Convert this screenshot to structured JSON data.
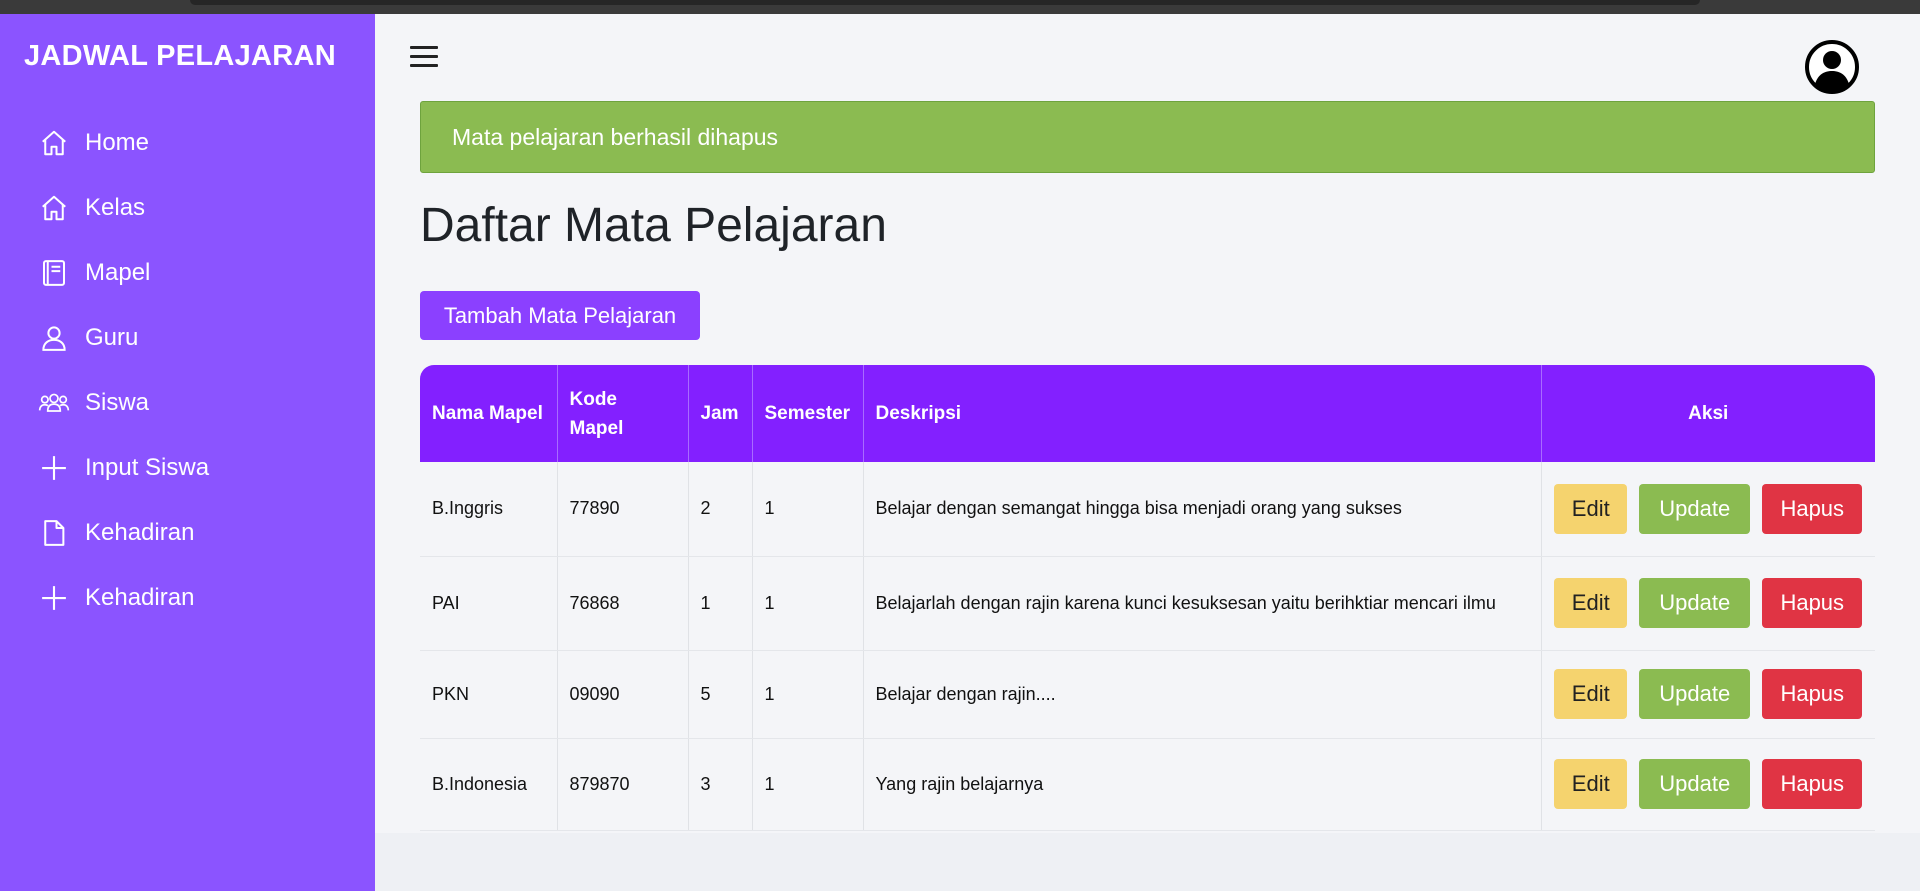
{
  "app": {
    "brand": "JADWAL PELAJARAN"
  },
  "sidebar": {
    "items": [
      {
        "label": "Home",
        "icon": "home-icon"
      },
      {
        "label": "Kelas",
        "icon": "home-icon"
      },
      {
        "label": "Mapel",
        "icon": "book-icon"
      },
      {
        "label": "Guru",
        "icon": "person-icon"
      },
      {
        "label": "Siswa",
        "icon": "people-icon"
      },
      {
        "label": "Input Siswa",
        "icon": "plus-icon"
      },
      {
        "label": "Kehadiran",
        "icon": "file-icon"
      },
      {
        "label": "Kehadiran",
        "icon": "plus-icon"
      }
    ]
  },
  "alert": {
    "message": "Mata pelajaran berhasil dihapus"
  },
  "page": {
    "title": "Daftar Mata Pelajaran",
    "add_button": "Tambah Mata Pelajaran"
  },
  "table": {
    "headers": [
      "Nama Mapel",
      "Kode Mapel",
      "Jam",
      "Semester",
      "Deskripsi",
      "Aksi"
    ],
    "rows": [
      {
        "nama": "B.Inggris",
        "kode": "77890",
        "jam": "2",
        "semester": "1",
        "deskripsi": "Belajar dengan semangat hingga bisa menjadi orang yang sukses"
      },
      {
        "nama": "PAI",
        "kode": "76868",
        "jam": "1",
        "semester": "1",
        "deskripsi": "Belajarlah dengan rajin karena kunci kesuksesan yaitu berihktiar mencari ilmu"
      },
      {
        "nama": "PKN",
        "kode": "09090",
        "jam": "5",
        "semester": "1",
        "deskripsi": "Belajar dengan rajin...."
      },
      {
        "nama": "B.Indonesia",
        "kode": "879870",
        "jam": "3",
        "semester": "1",
        "deskripsi": "Yang rajin belajarnya"
      }
    ],
    "actions": {
      "edit": "Edit",
      "update": "Update",
      "delete": "Hapus"
    }
  },
  "colors": {
    "sidebar": "#8b54ff",
    "table_header": "#8320ff",
    "alert_success": "#8bbb51",
    "edit": "#f5d36e",
    "update": "#8bbb51",
    "delete": "#e03444"
  }
}
